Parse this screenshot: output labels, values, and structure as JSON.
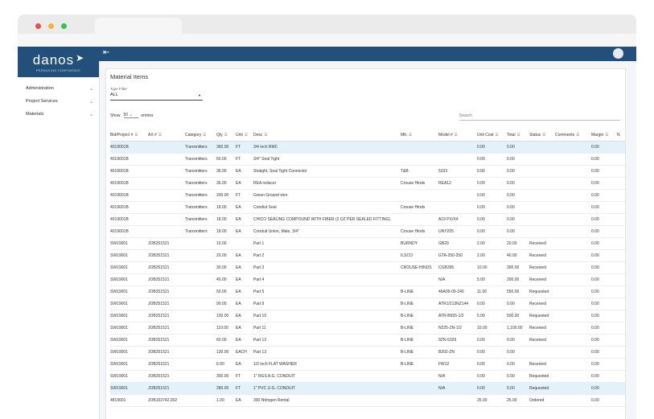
{
  "brand": {
    "name": "danos",
    "tagline": "PRODUCING CONFIDENCE"
  },
  "colors": {
    "primary": "#23507a",
    "highlight_row": "#e3f1fb",
    "dot_red": "#ee4b4b",
    "dot_yellow": "#f2b632",
    "dot_green": "#35c24f"
  },
  "sidebar": {
    "items": [
      {
        "label": "Administration",
        "icon": "chevron-down-icon"
      },
      {
        "label": "Project Services",
        "icon": "chevron-down-icon"
      },
      {
        "label": "Materials",
        "icon": "chevron-down-icon"
      }
    ]
  },
  "page": {
    "title": "Material Items",
    "type_filter_label": "Type Filter",
    "type_filter_value": "ALL",
    "show_label": "Show",
    "show_value": "50",
    "entries_label": "entries",
    "search_placeholder": "Search"
  },
  "table": {
    "columns": [
      "Bid/Project #",
      "AX #",
      "Category",
      "Qty",
      "Unit",
      "Desc",
      "Mfc",
      "Model #",
      "Unit Cost",
      "Total",
      "Status",
      "Comments",
      "Margin",
      "N"
    ],
    "rows": [
      {
        "bid": "4019001B",
        "ax": "",
        "cat": "Transmitters",
        "qty": "360.00",
        "unit": "FT",
        "desc": "3/4 inch RMC",
        "mfc": "",
        "model": "",
        "cost": "0.00",
        "total": "0.00",
        "status": "",
        "comments": "",
        "margin": "0.00",
        "hl": true
      },
      {
        "bid": "4019001B",
        "ax": "",
        "cat": "Transmitters",
        "qty": "60.00",
        "unit": "FT",
        "desc": "3/4\" Seal Tight",
        "mfc": "",
        "model": "",
        "cost": "0.00",
        "total": "0.00",
        "status": "",
        "comments": "",
        "margin": "0.00",
        "hl": false
      },
      {
        "bid": "4019001B",
        "ax": "",
        "cat": "Transmitters",
        "qty": "36.00",
        "unit": "EA",
        "desc": "Straight, Seal Tight Connector",
        "mfc": "T&B",
        "model": "5333",
        "cost": "0.00",
        "total": "0.00",
        "status": "",
        "comments": "",
        "margin": "0.00",
        "hl": false
      },
      {
        "bid": "4019001B",
        "ax": "",
        "cat": "Transmitters",
        "qty": "36.00",
        "unit": "EA",
        "desc": "REA reducer",
        "mfc": "Crouse Hinds",
        "model": "REA12",
        "cost": "0.00",
        "total": "0.00",
        "status": "",
        "comments": "",
        "margin": "0.00",
        "hl": false
      },
      {
        "bid": "4019001B",
        "ax": "",
        "cat": "Transmitters",
        "qty": "200.00",
        "unit": "FT",
        "desc": "Green Ground wire",
        "mfc": "",
        "model": "",
        "cost": "0.00",
        "total": "0.00",
        "status": "",
        "comments": "",
        "margin": "0.00",
        "hl": false
      },
      {
        "bid": "4019001B",
        "ax": "",
        "cat": "Transmitters",
        "qty": "18.00",
        "unit": "EA",
        "desc": "Condiut Seal",
        "mfc": "Crouse Hinds",
        "model": "",
        "cost": "0.00",
        "total": "0.00",
        "status": "",
        "comments": "",
        "margin": "0.00",
        "hl": false
      },
      {
        "bid": "4019001B",
        "ax": "",
        "cat": "Transmitters",
        "qty": "18.00",
        "unit": "EA",
        "desc": "CHICO SEALING COMPOUND WITH FIBER (2 OZ PER SEALED FITTING)",
        "mfc": "",
        "model": "A19 PX/X4",
        "cost": "0.00",
        "total": "0.00",
        "status": "",
        "comments": "",
        "margin": "0.00",
        "hl": false
      },
      {
        "bid": "4019001B",
        "ax": "",
        "cat": "Transmitters",
        "qty": "18.00",
        "unit": "EA",
        "desc": "Conduit Union, Male, 3/4\"",
        "mfc": "Crouse Hinds",
        "model": "UNY205",
        "cost": "0.00",
        "total": "0.00",
        "status": "",
        "comments": "",
        "margin": "0.00",
        "hl": false
      },
      {
        "bid": "SW19001",
        "ax": "JOB251521",
        "cat": "",
        "qty": "10.00",
        "unit": "",
        "desc": "Part 1",
        "mfc": "BURNDY",
        "model": "GB29",
        "cost": "2.00",
        "total": "20.00",
        "status": "Received",
        "comments": "",
        "margin": "0.00",
        "hl": false
      },
      {
        "bid": "SW19001",
        "ax": "JOB251521",
        "cat": "",
        "qty": "20.00",
        "unit": "EA",
        "desc": "Part 2",
        "mfc": "ILSCO",
        "model": "GTA-250-250",
        "cost": "2.00",
        "total": "40.00",
        "status": "Received",
        "comments": "",
        "margin": "0.00",
        "hl": false
      },
      {
        "bid": "SW19001",
        "ax": "JOB251521",
        "cat": "",
        "qty": "30.00",
        "unit": "EA",
        "desc": "Part 3",
        "mfc": "CROUSE-HINDS",
        "model": "CGB395",
        "cost": "10.00",
        "total": "300.00",
        "status": "Received",
        "comments": "",
        "margin": "0.00",
        "hl": false
      },
      {
        "bid": "SW19001",
        "ax": "JOB251521",
        "cat": "",
        "qty": "40.00",
        "unit": "EA",
        "desc": "Part 4",
        "mfc": "",
        "model": "N/A",
        "cost": "5.00",
        "total": "200.00",
        "status": "Received",
        "comments": "",
        "margin": "0.00",
        "hl": false
      },
      {
        "bid": "SW19001",
        "ax": "JOB251521",
        "cat": "",
        "qty": "50.00",
        "unit": "EA",
        "desc": "Part 5",
        "mfc": "B-LINE",
        "model": "46A09-09-240",
        "cost": "11.00",
        "total": "550.00",
        "status": "Requested",
        "comments": "",
        "margin": "0.00",
        "hl": false
      },
      {
        "bid": "SW19001",
        "ax": "JOB251521",
        "cat": "",
        "qty": "90.00",
        "unit": "EA",
        "desc": "Part 9",
        "mfc": "B-LINE",
        "model": "ATR1/213NZ144",
        "cost": "0.00",
        "total": "0.00",
        "status": "Received",
        "comments": "",
        "margin": "0.00",
        "hl": false
      },
      {
        "bid": "SW19001",
        "ax": "JOB251521",
        "cat": "",
        "qty": "100.00",
        "unit": "EA",
        "desc": "Part 10",
        "mfc": "B-LINE",
        "model": "ATR-B655-1/2",
        "cost": "5.00",
        "total": "500.00",
        "status": "Requested",
        "comments": "",
        "margin": "0.00",
        "hl": false
      },
      {
        "bid": "SW19001",
        "ax": "JOB251521",
        "cat": "",
        "qty": "110.00",
        "unit": "EA",
        "desc": "Part 11",
        "mfc": "B-LINE",
        "model": "N225-ZN-1/2",
        "cost": "10.00",
        "total": "1,100.00",
        "status": "Received",
        "comments": "",
        "margin": "0.00",
        "hl": false
      },
      {
        "bid": "SW19001",
        "ax": "JOB251521",
        "cat": "",
        "qty": "60.00",
        "unit": "EA",
        "desc": "Part 12",
        "mfc": "B-LINE",
        "model": "9ZN-5326",
        "cost": "0.00",
        "total": "0.00",
        "status": "Received",
        "comments": "",
        "margin": "0.00",
        "hl": false
      },
      {
        "bid": "SW19001",
        "ax": "JOB251521",
        "cat": "",
        "qty": "130.00",
        "unit": "EACH",
        "desc": "Part 13",
        "mfc": "B-LINE",
        "model": "B202-ZN",
        "cost": "0.00",
        "total": "0.00",
        "status": "",
        "comments": "",
        "margin": "0.00",
        "hl": false
      },
      {
        "bid": "SW19001",
        "ax": "JOB251521",
        "cat": "",
        "qty": "6.00",
        "unit": "EA",
        "desc": "1/2 inch FLAT WASHER",
        "mfc": "B-LINE",
        "model": "FW12",
        "cost": "0.00",
        "total": "0.00",
        "status": "Received",
        "comments": "",
        "margin": "0.00",
        "hl": false
      },
      {
        "bid": "SW19001",
        "ax": "JOB251521",
        "cat": "",
        "qty": "300.00",
        "unit": "FT",
        "desc": "1\" RGS A.G. CONDUIT",
        "mfc": "",
        "model": "N/A",
        "cost": "0.00",
        "total": "0.00",
        "status": "Requested",
        "comments": "",
        "margin": "0.00",
        "hl": false
      },
      {
        "bid": "SW19001",
        "ax": "JOB251521",
        "cat": "",
        "qty": "280.00",
        "unit": "FT",
        "desc": "1\" PVC U.G. CONDUIT",
        "mfc": "",
        "model": "N/A",
        "cost": "0.00",
        "total": "0.00",
        "status": "Requested",
        "comments": "",
        "margin": "0.00",
        "hl": true
      },
      {
        "bid": "4819001",
        "ax": "JOB103742.002",
        "cat": "",
        "qty": "1.00",
        "unit": "EA",
        "desc": "300 Nitrogen Rental",
        "mfc": "",
        "model": "",
        "cost": "25.00",
        "total": "25.00",
        "status": "Ordered",
        "comments": "",
        "margin": "0.00",
        "hl": false
      }
    ]
  }
}
